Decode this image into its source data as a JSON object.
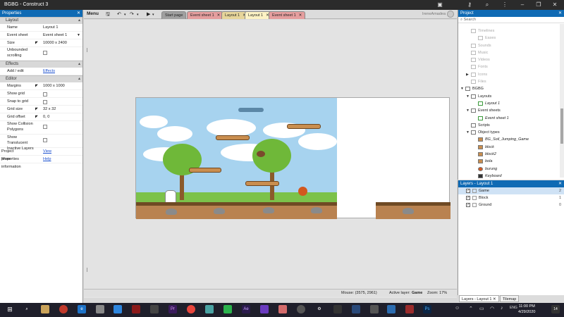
{
  "window": {
    "title": "BGBG - Construct 3"
  },
  "properties": {
    "header": "Properties",
    "layout_section": "Layout",
    "name_label": "Name",
    "name_value": "Layout 1",
    "event_sheet_label": "Event sheet",
    "event_sheet_value": "Event sheet 1",
    "size_label": "Size",
    "size_value": "10000 x 2400",
    "unbounded_label": "Unbounded scrolling",
    "effects_section": "Effects",
    "add_edit_label": "Add / edit",
    "add_edit_link": "Effects",
    "editor_section": "Editor",
    "margins_label": "Margins",
    "margins_value": "1000 x 1000",
    "show_grid_label": "Show grid",
    "snap_label": "Snap to grid",
    "grid_size_label": "Grid size",
    "grid_size_value": "32 x 32",
    "grid_offset_label": "Grid offset",
    "grid_offset_value": "0, 0",
    "show_collision_label": "Show Collision Polygons",
    "show_translucent_label": "Show Translucent Inactive Layers",
    "project_props_label": "Project properties",
    "project_props_link": "View",
    "more_info_label": "More information",
    "more_info_link": "Help"
  },
  "toolbar": {
    "menu_label": "Menu",
    "tabs": [
      {
        "label": "Start page"
      },
      {
        "label": "Event sheet 1"
      },
      {
        "label": "Layout 1"
      },
      {
        "label": "Layout 1"
      },
      {
        "label": "Event sheet 1"
      }
    ],
    "username": "IreneAmadea"
  },
  "status": {
    "mouse": "Mouse: (3575, 2961)",
    "active_layer_label": "Active layer:",
    "active_layer_value": "Game",
    "zoom": "Zoom: 17%"
  },
  "project": {
    "header": "Project",
    "search_placeholder": "Search",
    "items": [
      {
        "label": "Timelines"
      },
      {
        "label": "Eases"
      },
      {
        "label": "Sounds"
      },
      {
        "label": "Music"
      },
      {
        "label": "Videos"
      },
      {
        "label": "Fonts"
      },
      {
        "label": "Icons"
      },
      {
        "label": "Files"
      },
      {
        "label": "BGBG"
      },
      {
        "label": "Layouts"
      },
      {
        "label": "Layout 1"
      },
      {
        "label": "Event sheets"
      },
      {
        "label": "Event sheet 1"
      },
      {
        "label": "Scripts"
      },
      {
        "label": "Object types"
      },
      {
        "label": "BG_Soil_Jumping_Game"
      },
      {
        "label": "block"
      },
      {
        "label": "block2"
      },
      {
        "label": "bola"
      },
      {
        "label": "burung"
      },
      {
        "label": "Keyboard"
      }
    ]
  },
  "layers": {
    "header": "Layers - Layout 1",
    "items": [
      {
        "name": "Game",
        "count": "2"
      },
      {
        "name": "Block",
        "count": "1"
      },
      {
        "name": "Ground",
        "count": "0"
      }
    ],
    "bottom_tab_1": "Layers - Layout 1",
    "bottom_tab_2": "Tilemap"
  },
  "taskbar": {
    "time": "11:00 PM",
    "date": "4/29/2020",
    "notif_count": "14"
  }
}
